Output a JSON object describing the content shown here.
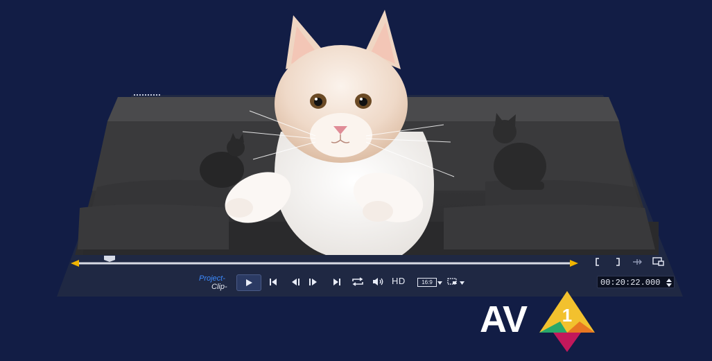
{
  "player": {
    "project_label": "Project-",
    "clip_label": "Clip-",
    "hd_label": "HD",
    "aspect_ratio": "16:9",
    "timecode": "00:20:22.000",
    "controls": {
      "play": "play-icon",
      "to_start": "skip-to-start-icon",
      "prev_frame": "previous-frame-icon",
      "next_frame": "next-frame-icon",
      "to_end": "skip-to-end-icon",
      "repeat": "repeat-icon",
      "volume": "volume-icon",
      "crop": "crop-icon",
      "mark_in": "mark-in-icon",
      "mark_out": "mark-out-icon",
      "split": "split-clip-icon",
      "fullscreen": "enlarge-preview-icon"
    }
  },
  "logo": {
    "text": "AV",
    "superscript": "1",
    "colors": {
      "yellow": "#f2c12e",
      "green": "#29a86a",
      "magenta": "#c2185b",
      "orange": "#e87722"
    }
  },
  "colors": {
    "background": "#121d45",
    "panel": "#27304f",
    "accent_blue": "#3d8bff",
    "scrubber_handle": "#f0b400"
  }
}
